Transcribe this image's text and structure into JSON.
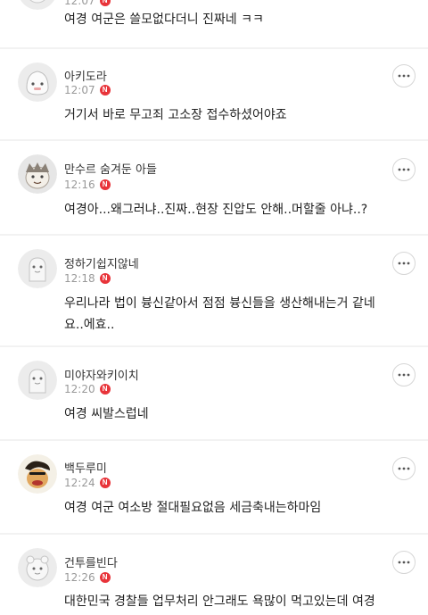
{
  "comments": [
    {
      "nickname": "",
      "time": "12:07",
      "badge": "N",
      "text": "여경 여군은 쓸모없다더니 진짜네 ㅋㅋ"
    },
    {
      "nickname": "아키도라",
      "time": "12:07",
      "badge": "N",
      "text": "거기서 바로 무고죄 고소장 접수하셨어야죠"
    },
    {
      "nickname": "만수르 숨겨둔 아들",
      "time": "12:16",
      "badge": "N",
      "text": "여경아...왜그러냐..진짜..현장 진압도 안해..머할줄 아냐..?"
    },
    {
      "nickname": "정하기쉽지않네",
      "time": "12:18",
      "badge": "N",
      "text_line1": "우리나라 법이 븅신같아서 점점 븅신들을 생산해내는거 같네",
      "text_line2": "요..에효.."
    },
    {
      "nickname": "미야자와키이치",
      "time": "12:20",
      "badge": "N",
      "text": "여경 씨발스럽네"
    },
    {
      "nickname": "백두루미",
      "time": "12:24",
      "badge": "N",
      "text": "여경 여군 여소방 절대필요없음 세금축내는하마임"
    },
    {
      "nickname": "건투를빈다",
      "time": "12:26",
      "badge": "N",
      "text": "대한민국 경찰들 업무처리 안그래도 욕많이 먹고있는데 여경"
    }
  ]
}
